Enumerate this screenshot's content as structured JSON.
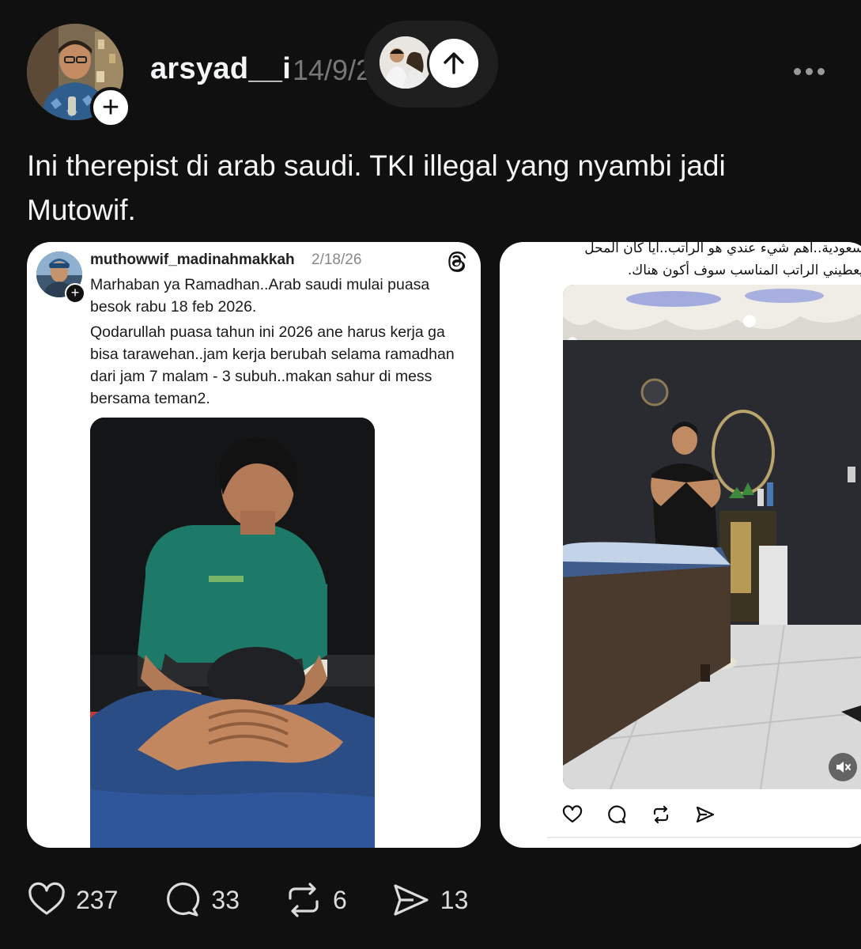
{
  "post": {
    "username": "arsyad__i",
    "timestamp": "14/9/2",
    "follow_symbol": "+",
    "caption": "Ini therepist di arab saudi. TKI illegal yang nyambi jadi Mutowif."
  },
  "embedded_left": {
    "username": "muthowwif_madinahmakkah",
    "date": "2/18/26",
    "follow_symbol": "+",
    "paragraph_1": "Marhaban ya Ramadhan..Arab saudi mulai puasa besok rabu 18 feb 2026.",
    "paragraph_2": "Qodarullah puasa tahun ini 2026 ane harus kerja ga bisa tarawehan..jam kerja berubah selama ramadhan dari jam 7 malam -  3 subuh..makan sahur di mess bersama teman2."
  },
  "embedded_right": {
    "arabic_line_1": "سعودية..أهم شيء عندي هو الراتب..أيا كان المحل",
    "arabic_line_2": "يعطيني الراتب المناسب سوف أكون هناك."
  },
  "actions": {
    "likes": "237",
    "replies": "33",
    "reposts": "6",
    "shares": "13"
  },
  "icons": [
    "plus-icon",
    "more-icon",
    "arrow-up-icon",
    "threads-logo-icon",
    "heart-icon",
    "comment-icon",
    "repost-icon",
    "share-icon",
    "mute-icon"
  ]
}
